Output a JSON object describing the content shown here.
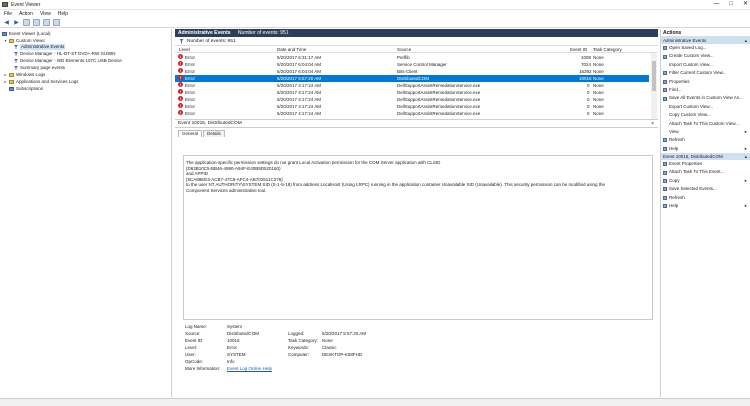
{
  "window": {
    "title": "Event Viewer",
    "controls": [
      "—",
      "□",
      "✕"
    ]
  },
  "menu": [
    "File",
    "Action",
    "View",
    "Help"
  ],
  "tree": {
    "root": "Event Viewer (Local)",
    "custom_views": "Custom Views",
    "admin_events": "Administrative Events",
    "device_manager_1": "Device Manager - HL-DT-ST DVD+-RW GU90N",
    "device_manager_2": "Device Manager - WD Elements 107C USB Device",
    "summary": "Summary page events",
    "windows_logs": "Windows Logs",
    "app_logs": "Applications and Services Logs",
    "subscriptions": "Subscriptions"
  },
  "main": {
    "header_title": "Administrative Events",
    "header_count": "Number of events: 951",
    "count_label": "Number of events: 951",
    "columns": {
      "level": "Level",
      "datetime": "Date and Time",
      "source": "Source",
      "eventid": "Event ID",
      "category": "Task Category"
    },
    "rows": [
      {
        "level": "Error",
        "datetime": "5/20/2017 6:31:17 AM",
        "source": "Perflib",
        "eventid": "1008",
        "category": "None"
      },
      {
        "level": "Error",
        "datetime": "5/20/2017 6:04:04 AM",
        "source": "Service Control Manager",
        "eventid": "7024",
        "category": "None"
      },
      {
        "level": "Error",
        "datetime": "5/20/2017 6:04:04 AM",
        "source": "Bits-Client",
        "eventid": "16392",
        "category": "None"
      },
      {
        "level": "Error",
        "datetime": "5/20/2017 5:57:20 AM",
        "source": "DistributedCOM",
        "eventid": "10016",
        "category": "None"
      },
      {
        "level": "Error",
        "datetime": "5/20/2017 4:17:24 AM",
        "source": "DellSupportAssistRemedationService.exe",
        "eventid": "0",
        "category": "None"
      },
      {
        "level": "Error",
        "datetime": "5/20/2017 4:17:24 AM",
        "source": "DellSupportAssistRemedationService.exe",
        "eventid": "0",
        "category": "None"
      },
      {
        "level": "Error",
        "datetime": "5/20/2017 4:17:24 AM",
        "source": "DellSupportAssistRemedationService.exe",
        "eventid": "0",
        "category": "None"
      },
      {
        "level": "Error",
        "datetime": "5/20/2017 4:17:24 AM",
        "source": "DellSupportAssistRemedationService.exe",
        "eventid": "0",
        "category": "None"
      },
      {
        "level": "Error",
        "datetime": "5/20/2017 4:17:24 AM",
        "source": "DellSupportAssistRemedationService.exe",
        "eventid": "0",
        "category": "None"
      }
    ]
  },
  "detail": {
    "header": "Event 10016, DistributedCOM",
    "close": "×",
    "tab_general": "General",
    "tab_details": "Details",
    "lines": [
      "The application-specific permission settings do not grant Local Activation permission for the COM Server application with CLSID",
      "{D63B10C5-BB46-4990-A94F-E40B9D520160}",
      " and APPID",
      "{9CA88EE3-ACB7-47C8-AFC4-AB702511C276}",
      " to the user NT AUTHORITY\\SYSTEM SID (S-1-5-18) from address LocalHost (Using LRPC) running in the application container Unavailable SID (Unavailable). This security permission can be modified using the",
      "Component Services administrative tool."
    ],
    "props": {
      "log_name_label": "Log Name:",
      "log_name": "System",
      "source_label": "Source:",
      "source": "DistributedCOM",
      "logged_label": "Logged:",
      "logged": "5/20/2017 5:57:20 AM",
      "eventid_label": "Event ID:",
      "eventid": "10016",
      "taskcat_label": "Task Category:",
      "taskcat": "None",
      "level_label": "Level:",
      "level": "Error",
      "keywords_label": "Keywords:",
      "keywords": "Classic",
      "user_label": "User:",
      "user": "SYSTEM",
      "computer_label": "Computer:",
      "computer": "DESKTOP-K58FHD",
      "opcode_label": "OpCode:",
      "opcode": "Info",
      "moreinfo_label": "More Information:",
      "moreinfo": "Event Log Online Help"
    }
  },
  "actions": {
    "title": "Actions",
    "section1": "Administrative Events",
    "items1": [
      "Open Saved Log...",
      "Create Custom View...",
      "Import Custom View...",
      "Filter Current Custom View...",
      "Properties",
      "Find...",
      "Save All Events in Custom View As...",
      "Export Custom View...",
      "Copy Custom View...",
      "Attach Task To This Custom View...",
      "View",
      "Refresh",
      "Help"
    ],
    "section2": "Event 10016, DistributedCOM",
    "items2": [
      "Event Properties",
      "Attach Task To This Event...",
      "Copy",
      "Save Selected Events...",
      "Refresh",
      "Help"
    ]
  },
  "colors": {
    "header_bg": "#2b3f5c",
    "selection": "#0078d7",
    "action_section": "#cfe0f5",
    "error": "#c9272d"
  }
}
